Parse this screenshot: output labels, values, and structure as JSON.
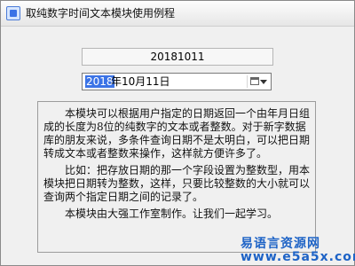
{
  "window": {
    "title": "取纯数字时间文本模块使用例程"
  },
  "fields": {
    "numeric_date": "20181011",
    "date_picker": {
      "year_selected": "2018",
      "rest": "年10月11日"
    }
  },
  "textbox": {
    "paragraphs": [
      "本模块可以根据用户指定的日期返回一个由年月日组成的长度为8位的纯数字的文本或者整数。对于新字数据库的朋友来说，多条件查询日期不是太明白，可以把日期转成文本或者整数来操作，这样就方便许多了。",
      "比如：把存放日期的那一个字段设置为整数型，用本模块把日期转为整数，这样，只要比较整数的大小就可以查询两个指定日期之间的记录了。",
      "本模块由大强工作室制作。让我们一起学习。"
    ]
  },
  "watermark": {
    "line1": "易语言资源网",
    "line2": "www.e5a5x.com"
  },
  "colors": {
    "selection": "#3b73e6",
    "watermark": "#1e63c6"
  },
  "icons": {
    "app": "app-icon",
    "calendar": "calendar-icon",
    "dropdown": "chevron-down-icon"
  }
}
